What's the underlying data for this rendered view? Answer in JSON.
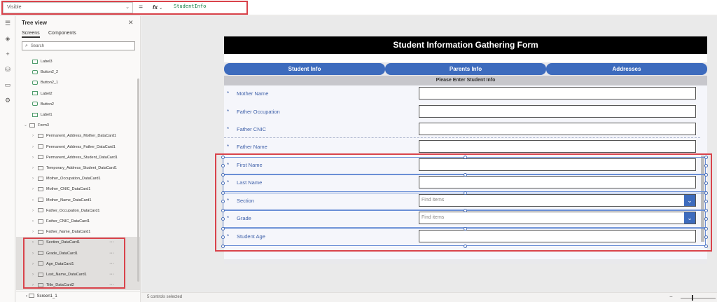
{
  "formula_bar": {
    "property": "Visible",
    "fx_label": "fx",
    "formula": "StudentInfo"
  },
  "tree_view": {
    "title": "Tree view",
    "tabs": [
      "Screens",
      "Components"
    ],
    "search_placeholder": "Search",
    "items": [
      {
        "label": "Label3",
        "type": "label"
      },
      {
        "label": "Button2_2",
        "type": "button"
      },
      {
        "label": "Button2_1",
        "type": "button"
      },
      {
        "label": "Label2",
        "type": "label"
      },
      {
        "label": "Button2",
        "type": "button"
      },
      {
        "label": "Label1",
        "type": "label"
      },
      {
        "label": "Form3",
        "type": "form"
      },
      {
        "label": "Permanent_Address_Mother_DataCard1",
        "type": "card"
      },
      {
        "label": "Permanent_Address_Father_DataCard1",
        "type": "card"
      },
      {
        "label": "Permanent_Address_Student_DataCard1",
        "type": "card"
      },
      {
        "label": "Temporary_Address_Student_DataCard1",
        "type": "card"
      },
      {
        "label": "Mother_Occupation_DataCard1",
        "type": "card"
      },
      {
        "label": "Mother_CNIC_DataCard1",
        "type": "card"
      },
      {
        "label": "Mother_Name_DataCard1",
        "type": "card"
      },
      {
        "label": "Father_Occupation_DataCard1",
        "type": "card"
      },
      {
        "label": "Father_CNIC_DataCard1",
        "type": "card"
      },
      {
        "label": "Father_Name_DataCard1",
        "type": "card"
      },
      {
        "label": "Section_DataCard1",
        "type": "card"
      },
      {
        "label": "Grade_DataCard1",
        "type": "card"
      },
      {
        "label": "Age_DataCard1",
        "type": "card"
      },
      {
        "label": "Last_Name_DataCard1",
        "type": "card"
      },
      {
        "label": "Title_DataCard2",
        "type": "card"
      }
    ],
    "screen": "Screen1_1"
  },
  "form": {
    "title": "Student Information Gathering Form",
    "nav_buttons": [
      "Student Info",
      "Parents Info",
      "Addresses"
    ],
    "info_text": "Please Enter Student Info",
    "required_mark": "*",
    "fields": [
      {
        "label": "Mother Name",
        "kind": "text"
      },
      {
        "label": "Father Occupation",
        "kind": "text"
      },
      {
        "label": "Father CNIC",
        "kind": "text"
      },
      {
        "label": "Father Name",
        "kind": "text"
      },
      {
        "label": "First Name",
        "kind": "text"
      },
      {
        "label": "Last Name",
        "kind": "text"
      },
      {
        "label": "Section",
        "kind": "dropdown",
        "placeholder": "Find items"
      },
      {
        "label": "Grade",
        "kind": "dropdown",
        "placeholder": "Find items"
      },
      {
        "label": "Student Age",
        "kind": "text"
      }
    ]
  },
  "status_bar": {
    "text": "5 controls selected"
  },
  "colors": {
    "accent": "#3d6bbd",
    "highlight": "#d9434b",
    "title_bar": "#000000",
    "label_text": "#3d5fa8"
  }
}
